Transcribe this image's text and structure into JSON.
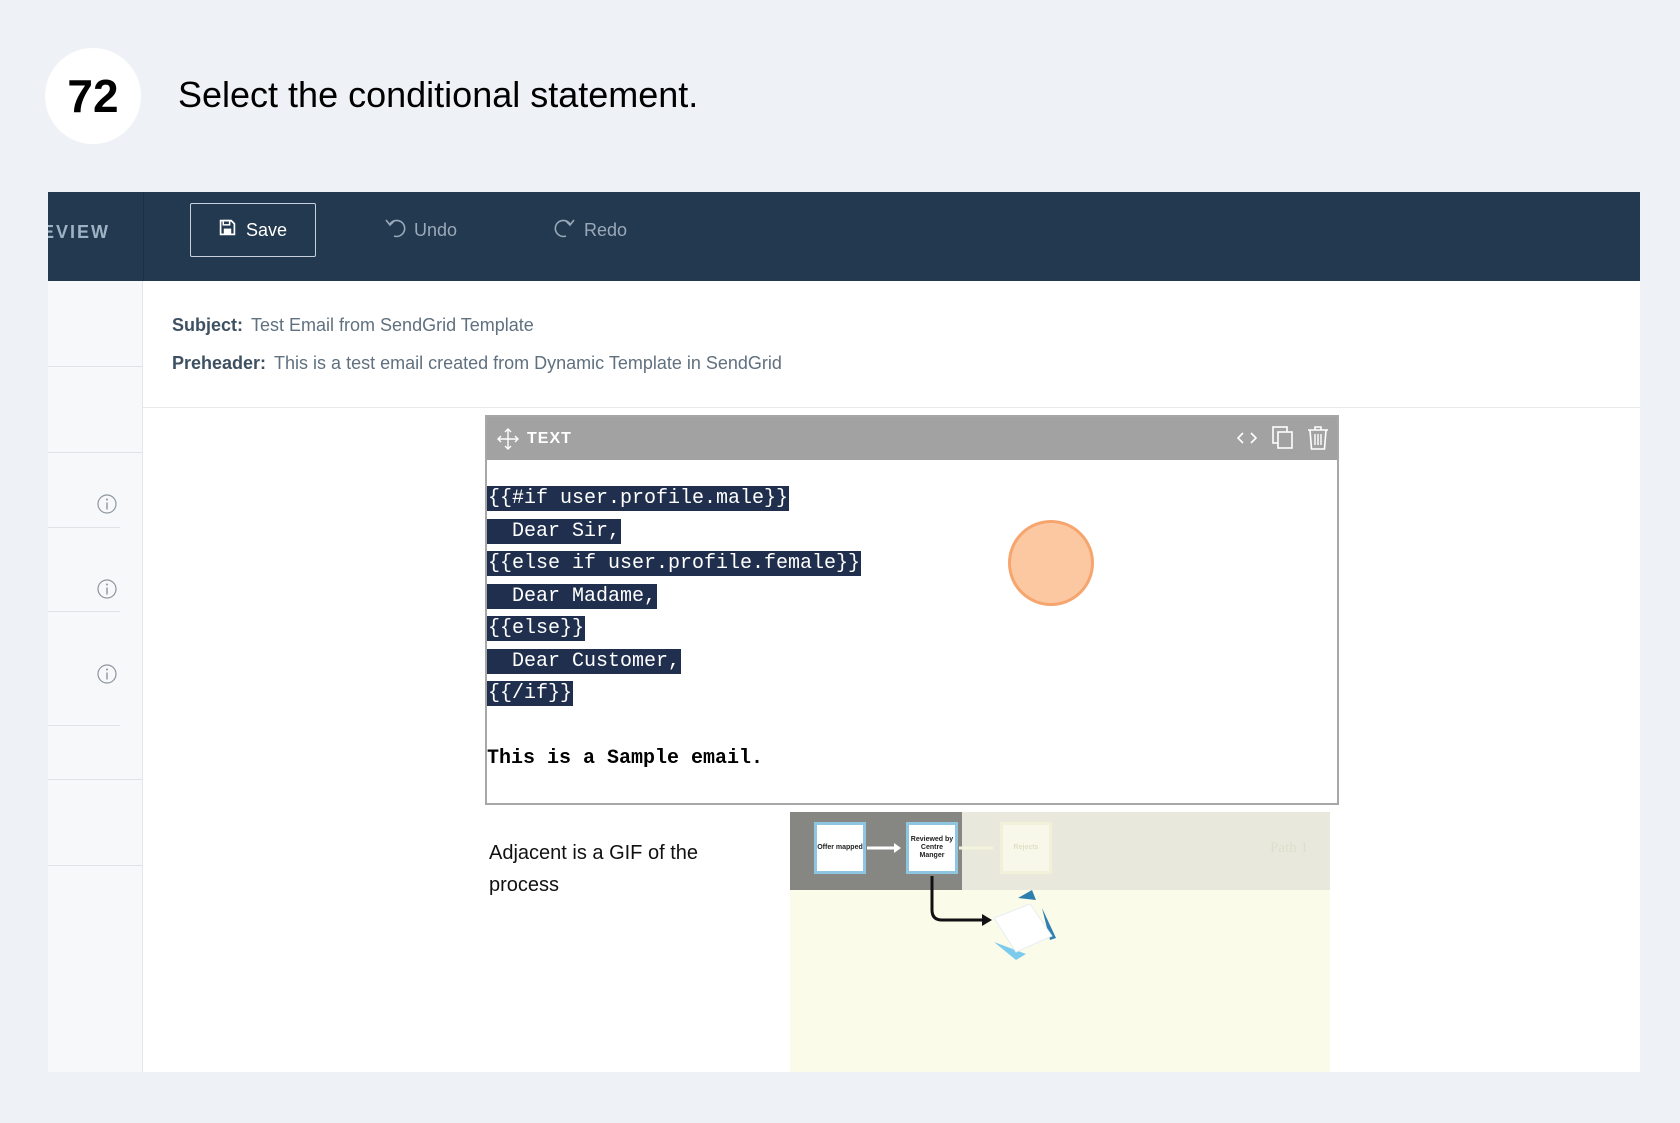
{
  "step": {
    "number": "72",
    "title": "Select the conditional statement."
  },
  "toolbar": {
    "tab_label": "EVIEW",
    "save_label": "Save",
    "undo_label": "Undo",
    "redo_label": "Redo"
  },
  "meta": {
    "subject_label": "Subject:",
    "subject_value": "Test Email from SendGrid Template",
    "preheader_label": "Preheader:",
    "preheader_value": "This is a test email created from Dynamic Template in SendGrid"
  },
  "text_module": {
    "title": "TEXT",
    "code_lines": [
      "{{#if user.profile.male}}",
      "  Dear Sir,",
      "{{else if user.profile.female}}",
      "  Dear Madame,",
      "{{else}}",
      "  Dear Customer,",
      "{{/if}}"
    ],
    "sample_text": "This is a Sample email."
  },
  "gif_section": {
    "caption": "Adjacent is a GIF of the process",
    "nodes": [
      "Offer mapped",
      "Reviewed by Centre Manger",
      "Rejects"
    ],
    "path_label": "Path 1"
  },
  "colors": {
    "toolbar_bg": "#23394f",
    "selection_bg": "#1f2f4d",
    "click_indicator": "#fcc8a2"
  }
}
